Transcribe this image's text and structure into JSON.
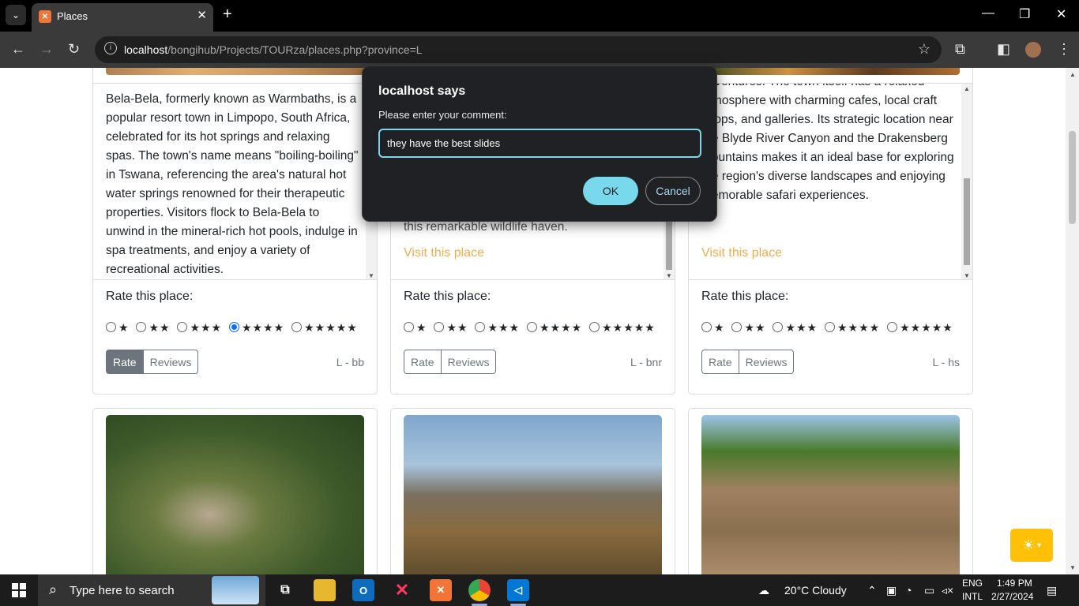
{
  "browser": {
    "tab_title": "Places",
    "url_host": "localhost",
    "url_path": "/bongihub/Projects/TOURza/places.php?province=L"
  },
  "dialog": {
    "title": "localhost says",
    "message": "Please enter your comment:",
    "input_value": "they have the best slides",
    "ok_label": "OK",
    "cancel_label": "Cancel"
  },
  "cards": [
    {
      "description": "Bela-Bela, formerly known as Warmbaths, is a popular resort town in Limpopo, South Africa, celebrated for its hot springs and relaxing spas. The town's name means \"boiling-boiling\" in Tswana, referencing the area's natural hot water springs renowned for their therapeutic properties. Visitors flock to Bela-Bela to unwind in the mineral-rich hot pools, indulge in spa treatments, and enjoy a variety of recreational activities.",
      "rate_label": "Rate this place:",
      "rate_btn": "Rate",
      "reviews_btn": "Reviews",
      "code": "L - bb",
      "selected_rating": 4
    },
    {
      "description": "this remarkable wildlife haven.",
      "visit": "Visit this place",
      "rate_label": "Rate this place:",
      "rate_btn": "Rate",
      "reviews_btn": "Reviews",
      "code": "L - bnr",
      "selected_rating": 0
    },
    {
      "description": "adventures. The town itself has a relaxed atmosphere with charming cafes, local craft shops, and galleries. Its strategic location near the Blyde River Canyon and the Drakensberg Mountains makes it an ideal base for exploring the region's diverse landscapes and enjoying memorable safari experiences.",
      "visit": "Visit this place",
      "rate_label": "Rate this place:",
      "rate_btn": "Rate",
      "reviews_btn": "Reviews",
      "code": "L - hs",
      "selected_rating": 0
    }
  ],
  "stars": [
    "★",
    "★★",
    "★★★",
    "★★★★",
    "★★★★★"
  ],
  "taskbar": {
    "search_placeholder": "Type here to search",
    "weather": "20°C  Cloudy",
    "lang_top": "ENG",
    "lang_bottom": "INTL",
    "time": "1:49 PM",
    "date": "2/27/2024"
  },
  "colors": {
    "link": "#f0ad4e",
    "dialog_accent": "#78d9ec",
    "theme_button": "#ffc107"
  }
}
